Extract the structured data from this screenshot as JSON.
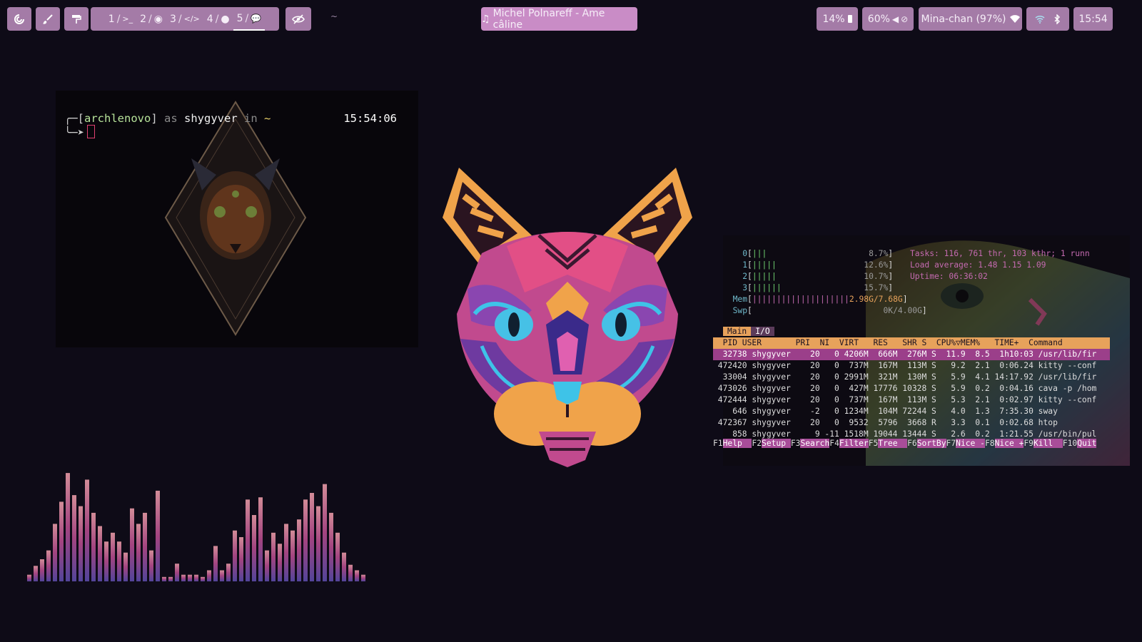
{
  "bar": {
    "launcher_icons": [
      "spiral-icon",
      "brush-icon",
      "paint-roller-icon"
    ],
    "workspaces": [
      {
        "num": "1",
        "icon": "terminal-icon",
        "glyph": ">_"
      },
      {
        "num": "2",
        "icon": "chrome-icon",
        "glyph": "◉"
      },
      {
        "num": "3",
        "icon": "code-icon",
        "glyph": "</>"
      },
      {
        "num": "4",
        "icon": "spotify-icon",
        "glyph": "●"
      },
      {
        "num": "5",
        "icon": "chat-icon",
        "glyph": "💬",
        "active": true
      }
    ],
    "separator": "/",
    "eye_icon": "eye-slash-icon",
    "window_title": "~",
    "music": "Michel Polnareff - Ame câline",
    "brightness": "14%",
    "volume": "60%",
    "wifi": "Mina-chan (97%)",
    "clock": "15:54"
  },
  "terminal": {
    "host": "archlenovo",
    "as": "as",
    "user": "shygyver",
    "in": "in",
    "dir": "~",
    "time": "15:54:06"
  },
  "htop": {
    "cpu": [
      {
        "id": "0",
        "bars": "|||",
        "pct": "8.7%"
      },
      {
        "id": "1",
        "bars": "|||||",
        "pct": "12.6%"
      },
      {
        "id": "2",
        "bars": "|||||",
        "pct": "10.7%"
      },
      {
        "id": "3",
        "bars": "||||||",
        "pct": "15.7%"
      }
    ],
    "mem": {
      "bars": "||||||||||||||||||||",
      "value": "2.98G/7.68G"
    },
    "swp": {
      "value": "0K/4.00G"
    },
    "tasks": "Tasks: 116, 761 thr, 103 kthr; 1 runn",
    "load": "Load average: 1.48 1.15 1.09",
    "uptime": "Uptime: 06:36:02",
    "tabs": [
      "Main",
      "I/O"
    ],
    "header": "  PID USER       PRI  NI  VIRT   RES   SHR S  CPU%▽MEM%   TIME+  Command",
    "rows": [
      "32738 shygyver    20   0 4206M  666M  276M S  11.9  8.5  1h10:03 /usr/lib/fir",
      "472420 shygyver    20   0  737M  167M  113M S   9.2  2.1  0:06.24 kitty --conf",
      "33004 shygyver    20   0 2991M  321M  130M S   5.9  4.1 14:17.92 /usr/lib/fir",
      "473026 shygyver    20   0  427M 17776 10328 S   5.9  0.2  0:04.16 cava -p /hom",
      "472444 shygyver    20   0  737M  167M  113M S   5.3  2.1  0:02.97 kitty --conf",
      "646 shygyver    -2   0 1234M  104M 72244 S   4.0  1.3  7:35.30 sway",
      "472367 shygyver    20   0  9532  5796  3668 R   3.3  0.1  0:02.68 htop",
      "858 shygyver     9 -11 1518M 19044 13444 S   2.6  0.2  1:21.55 /usr/bin/pul"
    ],
    "fkeys": [
      {
        "key": "F1",
        "label": "Help  "
      },
      {
        "key": "F2",
        "label": "Setup "
      },
      {
        "key": "F3",
        "label": "Search"
      },
      {
        "key": "F4",
        "label": "Filter"
      },
      {
        "key": "F5",
        "label": "Tree  "
      },
      {
        "key": "F6",
        "label": "SortBy"
      },
      {
        "key": "F7",
        "label": "Nice -"
      },
      {
        "key": "F8",
        "label": "Nice +"
      },
      {
        "key": "F9",
        "label": "Kill  "
      },
      {
        "key": "F10",
        "label": "Quit"
      }
    ]
  },
  "cava": {
    "levels": [
      0.06,
      0.14,
      0.2,
      0.28,
      0.52,
      0.72,
      0.98,
      0.78,
      0.68,
      0.92,
      0.62,
      0.5,
      0.36,
      0.44,
      0.36,
      0.26,
      0.66,
      0.52,
      0.62,
      0.28,
      0.82,
      0.04,
      0.04,
      0.16,
      0.06,
      0.06,
      0.06,
      0.04,
      0.1,
      0.32,
      0.1,
      0.16,
      0.46,
      0.4,
      0.74,
      0.6,
      0.76,
      0.28,
      0.44,
      0.34,
      0.52,
      0.46,
      0.56,
      0.74,
      0.8,
      0.68,
      0.88,
      0.62,
      0.44,
      0.26,
      0.15,
      0.1,
      0.06
    ]
  }
}
